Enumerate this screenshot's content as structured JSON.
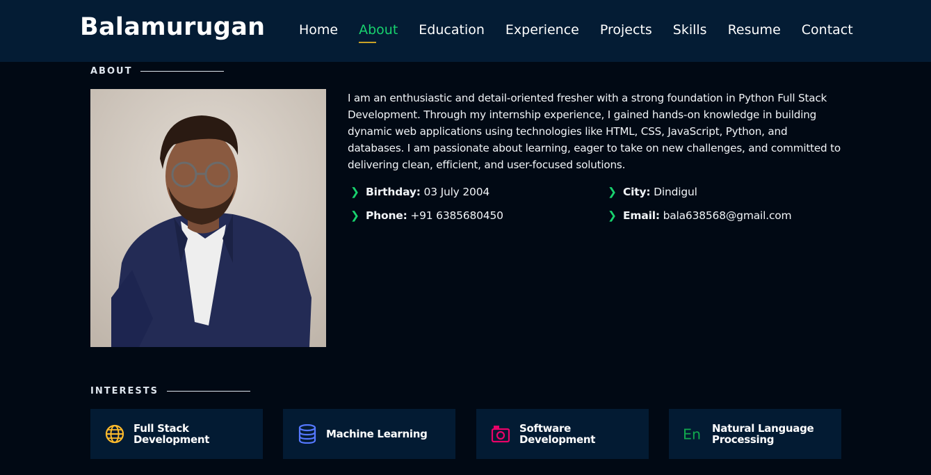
{
  "brand": "Balamurugan",
  "nav": {
    "items": [
      {
        "label": "Home"
      },
      {
        "label": "About"
      },
      {
        "label": "Education"
      },
      {
        "label": "Experience"
      },
      {
        "label": "Projects"
      },
      {
        "label": "Skills"
      },
      {
        "label": "Resume"
      },
      {
        "label": "Contact"
      }
    ],
    "active": "About"
  },
  "about": {
    "title": "ABOUT",
    "description": "I am an enthusiastic and detail-oriented fresher with a strong foundation in Python Full Stack Development. Through my internship experience, I gained hands-on knowledge in building dynamic web applications using technologies like HTML, CSS, JavaScript, Python, and databases. I am passionate about learning, eager to take on new challenges, and committed to delivering clean, efficient, and user-focused solutions.",
    "details": {
      "birthday": {
        "label": "Birthday:",
        "value": "03 July 2004"
      },
      "city": {
        "label": "City:",
        "value": "Dindigul"
      },
      "phone": {
        "label": "Phone:",
        "value": "+91 6385680450"
      },
      "email": {
        "label": "Email:",
        "value": "bala638568@gmail.com"
      }
    }
  },
  "interests": {
    "title": "INTERESTS",
    "items": [
      {
        "line1": "Full Stack",
        "line2": "Development",
        "icon": "globe-icon",
        "color": "#ffbb2c"
      },
      {
        "line1": "Machine Learning",
        "line2": "",
        "icon": "database-icon",
        "color": "#5578ff"
      },
      {
        "line1": "Software",
        "line2": "Development",
        "icon": "camera-icon",
        "color": "#e80368"
      },
      {
        "line1": "Natural Language",
        "line2": "Processing",
        "icon": "language-icon",
        "color": "#11dbcf"
      }
    ]
  },
  "colors": {
    "accent": "#18d26e",
    "header_bg": "#041c34",
    "page_bg": "#010914",
    "card_bg": "#031b33"
  }
}
